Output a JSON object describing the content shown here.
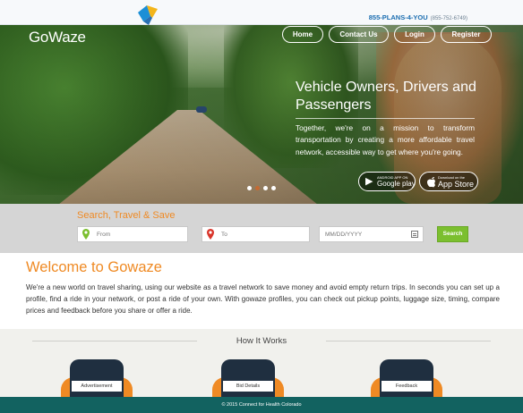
{
  "topbar": {
    "phone_main": "855-PLANS-4-YOU",
    "phone_alt": "(855-752-6749)"
  },
  "header": {
    "brand": "GoWaze",
    "nav": {
      "home": "Home",
      "contact": "Contact Us",
      "login": "Login",
      "register": "Register"
    }
  },
  "hero": {
    "title": "Vehicle Owners, Drivers and Passengers",
    "text": "Together, we're on a mission to transform transportation by creating a more affordable travel network, accessible way to get where you're going.",
    "google_play": {
      "small": "ANDROID APP ON",
      "big": "Google play"
    },
    "app_store": {
      "small": "Download on the",
      "big": "App Store"
    },
    "slides": 4,
    "active_slide": 2
  },
  "search": {
    "title": "Search, Travel & Save",
    "from_placeholder": "From",
    "to_placeholder": "To",
    "date_placeholder": "MM/DD/YYYY",
    "button": "Search"
  },
  "welcome": {
    "title": "Welcome to Gowaze",
    "text": "We're a new world on travel sharing, using our website as a travel network to save money and avoid empty return trips. In seconds you can set up a profile, find a ride in your network, or post a ride of your own. With gowaze profiles, you can check out pickup points, luggage size, timing, compare prices and feedback before you share or offer a ride."
  },
  "how_it_works": {
    "title": "How It Works",
    "cards": [
      "Advertisement",
      "Bid Details",
      "Feedback"
    ]
  },
  "footer": {
    "text": "© 2015 Connect for Health Colorado"
  },
  "colors": {
    "accent": "#ef8a24",
    "search_button": "#7bbf2f",
    "footer": "#126260",
    "phone_link": "#1a6db0"
  }
}
